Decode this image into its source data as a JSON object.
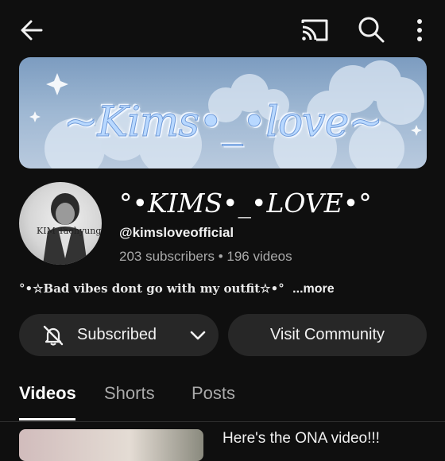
{
  "header": {
    "back_icon": "arrow-left-icon",
    "cast_icon": "cast-icon",
    "search_icon": "search-icon",
    "more_icon": "more-vertical-icon"
  },
  "banner": {
    "text": "~Kims•_•love~"
  },
  "channel": {
    "name": "°•KIMS•_•LOVE•°",
    "handle": "@kimsloveofficial",
    "stats": "203 subscribers • 196 videos",
    "avatar_text": "KIM Taehyung",
    "description": "°•☆Bad vibes dont go with my outfit☆•°",
    "more_label": "...more"
  },
  "actions": {
    "subscribed_label": "Subscribed",
    "community_label": "Visit Community"
  },
  "tabs": [
    {
      "label": "Videos",
      "active": true
    },
    {
      "label": "Shorts",
      "active": false
    },
    {
      "label": "Posts",
      "active": false
    }
  ],
  "video": {
    "title": "Here's the ONA video!!!"
  },
  "colors": {
    "background": "#0f0f0f",
    "button": "#272727",
    "muted_text": "#aaaaaa"
  }
}
